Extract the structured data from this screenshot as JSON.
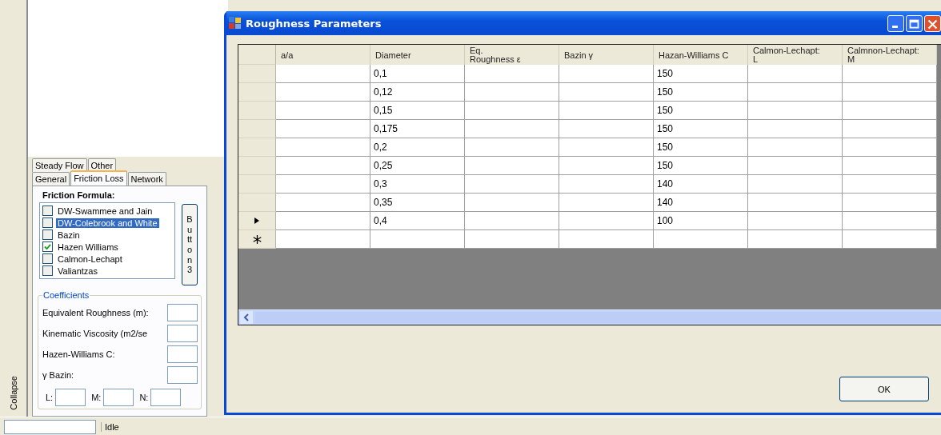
{
  "side_strip": {
    "label": "Collapse"
  },
  "tabs_row_1": [
    {
      "label": "Steady Flow",
      "selected": false
    },
    {
      "label": "Other",
      "selected": false
    }
  ],
  "tabs_row_2": [
    {
      "label": "General",
      "selected": false
    },
    {
      "label": "Friction Loss",
      "selected": true
    },
    {
      "label": "Network",
      "selected": false
    }
  ],
  "friction_formula": {
    "heading": "Friction Formula:",
    "items": [
      {
        "label": "DW-Swammee and Jain",
        "checked": false,
        "selected": false
      },
      {
        "label": "DW-Colebrook and White",
        "checked": false,
        "selected": true
      },
      {
        "label": "Bazin",
        "checked": false,
        "selected": false
      },
      {
        "label": "Hazen Williams",
        "checked": true,
        "selected": false
      },
      {
        "label": "Calmon-Lechapt",
        "checked": false,
        "selected": false
      },
      {
        "label": "Valiantzas",
        "checked": false,
        "selected": false
      }
    ],
    "button": "Button3"
  },
  "coefficients": {
    "title": "Coefficients",
    "fields": [
      {
        "label": "Equivalent Roughness (m):"
      },
      {
        "label": "Kinematic Viscosity (m2/se"
      },
      {
        "label": "Hazen-Williams C:"
      },
      {
        "label": "γ Bazin:"
      }
    ],
    "small_fields": [
      {
        "label": "L:"
      },
      {
        "label": "M:"
      },
      {
        "label": "N:"
      }
    ]
  },
  "status_bar": {
    "status": "Idle"
  },
  "dialog": {
    "title": "Roughness Parameters",
    "columns": [
      "a/a",
      "Diameter",
      "Eq.\nRoughness ε",
      "Bazin γ",
      "Hazan-Williams C",
      "Calmon-Lechapt:\nL",
      "Calmnon-Lechapt:\nM"
    ],
    "rows": [
      {
        "kind": "data",
        "current": false,
        "diameter": "0,1",
        "hazen_williams_c": "150"
      },
      {
        "kind": "data",
        "current": false,
        "diameter": "0,12",
        "hazen_williams_c": "150"
      },
      {
        "kind": "data",
        "current": false,
        "diameter": "0,15",
        "hazen_williams_c": "150"
      },
      {
        "kind": "data",
        "current": false,
        "diameter": "0,175",
        "hazen_williams_c": "150"
      },
      {
        "kind": "data",
        "current": false,
        "diameter": "0,2",
        "hazen_williams_c": "150"
      },
      {
        "kind": "data",
        "current": false,
        "diameter": "0,25",
        "hazen_williams_c": "150"
      },
      {
        "kind": "data",
        "current": false,
        "diameter": "0,3",
        "hazen_williams_c": "140"
      },
      {
        "kind": "data",
        "current": false,
        "diameter": "0,35",
        "hazen_williams_c": "140"
      },
      {
        "kind": "data",
        "current": true,
        "diameter": "0,4",
        "hazen_williams_c": "100"
      },
      {
        "kind": "new"
      }
    ],
    "ok_button": "OK"
  }
}
